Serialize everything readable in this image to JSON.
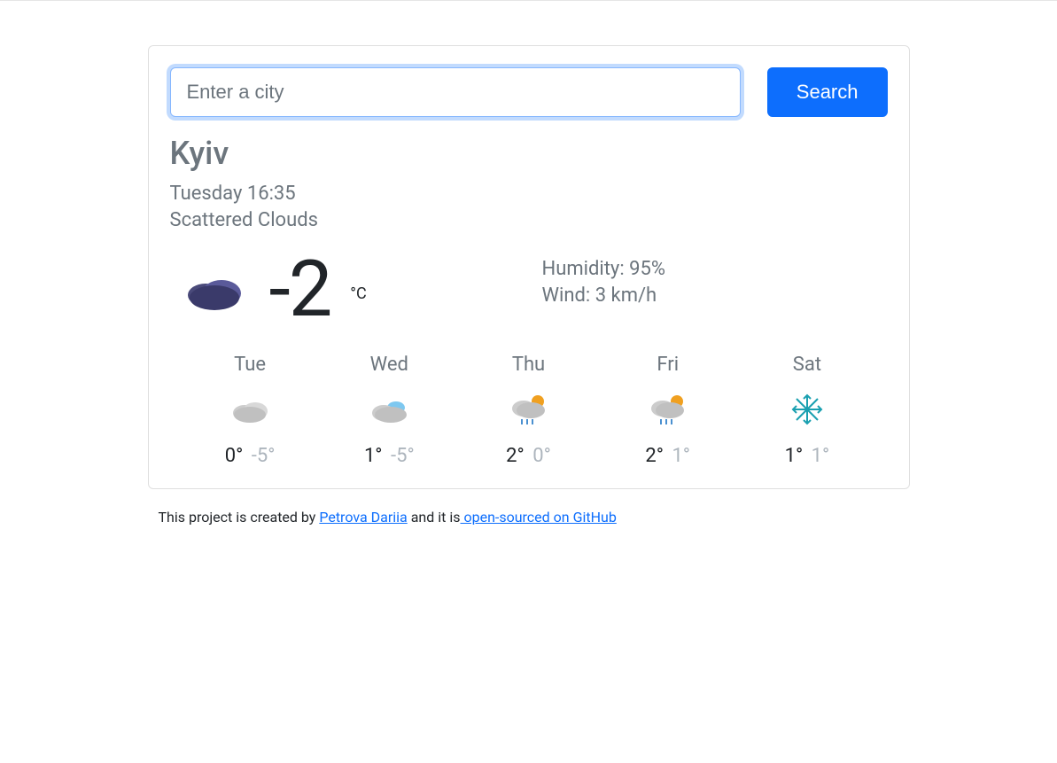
{
  "search": {
    "placeholder": "Enter a city",
    "button": "Search"
  },
  "city": "Kyiv",
  "datetime": "Tuesday 16:35",
  "description": "Scattered Clouds",
  "current": {
    "temp": "-2",
    "unit": "°C",
    "icon": "cloud-dark",
    "humidity_label": "Humidity: ",
    "humidity_value": "95%",
    "wind_label": "Wind: ",
    "wind_value": "3 km/h"
  },
  "forecast": [
    {
      "day": "Tue",
      "icon": "cloud",
      "hi": "0°",
      "lo": "-5°"
    },
    {
      "day": "Wed",
      "icon": "cloud-blue",
      "hi": "1°",
      "lo": "-5°"
    },
    {
      "day": "Thu",
      "icon": "rain-sun",
      "hi": "2°",
      "lo": "0°"
    },
    {
      "day": "Fri",
      "icon": "rain-sun",
      "hi": "2°",
      "lo": "1°"
    },
    {
      "day": "Sat",
      "icon": "snow",
      "hi": "1°",
      "lo": "1°"
    }
  ],
  "footer": {
    "prefix": "This project is created by ",
    "author": "Petrova Dariia",
    "mid": " and it is",
    "link": " open-sourced on GitHub"
  }
}
